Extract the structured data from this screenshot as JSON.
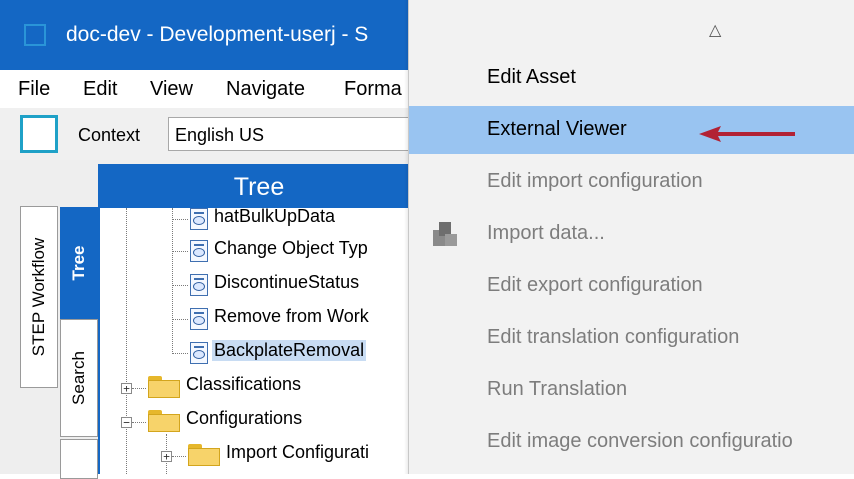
{
  "window": {
    "title": "doc-dev - Development-userj - S"
  },
  "menubar": {
    "items": [
      "File",
      "Edit",
      "View",
      "Navigate",
      "Forma"
    ]
  },
  "context": {
    "label": "Context",
    "value": "English US"
  },
  "panel": {
    "header": "Tree",
    "tabs": {
      "step_workflow": "STEP Workflow",
      "tree": "Tree",
      "search": "Search"
    }
  },
  "tree": {
    "doc_items": [
      "hatBulkUpData",
      "Change Object Typ",
      "DiscontinueStatus",
      "Remove from Work",
      "BackplateRemoval"
    ],
    "folders": [
      "Classifications",
      "Configurations",
      "Import Configurati"
    ]
  },
  "context_menu": {
    "items": [
      {
        "label": "Edit Asset",
        "state": "enabled"
      },
      {
        "label": "External Viewer",
        "state": "highlighted"
      },
      {
        "label": "Edit import configuration",
        "state": "disabled"
      },
      {
        "label": "Import data...",
        "state": "disabled",
        "icon": "import-data-icon"
      },
      {
        "label": "Edit export configuration",
        "state": "disabled"
      },
      {
        "label": "Edit translation configuration",
        "state": "disabled"
      },
      {
        "label": "Run Translation",
        "state": "disabled"
      },
      {
        "label": "Edit image conversion configuratio",
        "state": "disabled"
      }
    ],
    "scroll_up_glyph": "△"
  },
  "colors": {
    "title_bar": "#1467c4",
    "highlight": "#99c4f1",
    "arrow": "#b22234"
  }
}
